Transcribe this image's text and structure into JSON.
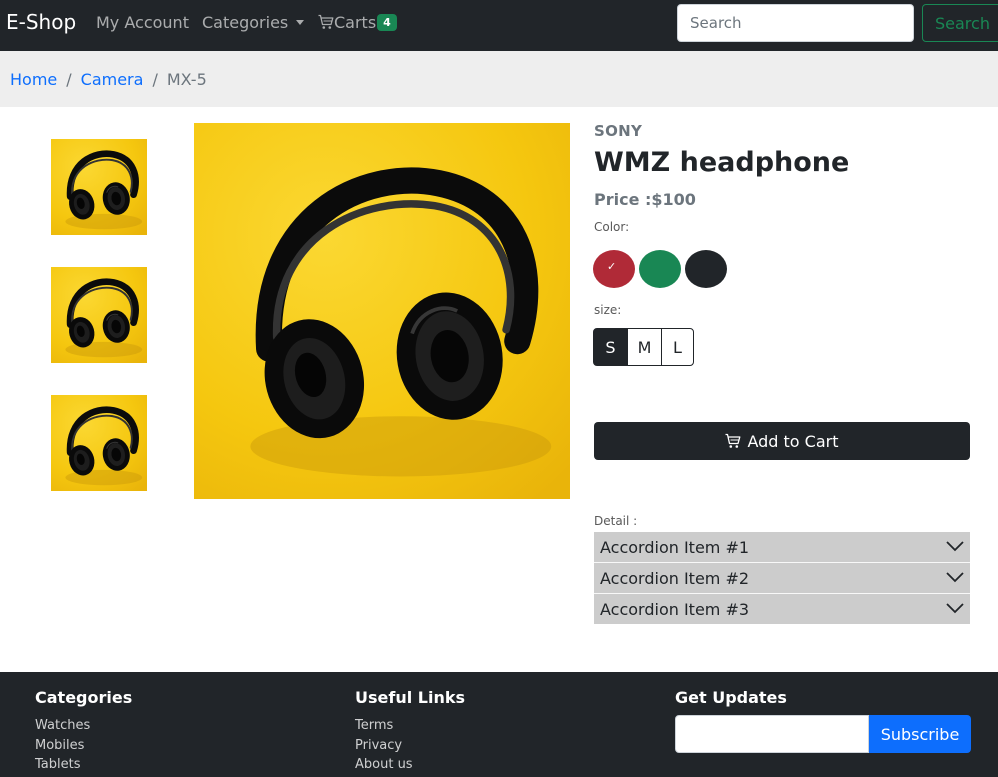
{
  "navbar": {
    "brand": "E-Shop",
    "my_account": "My Account",
    "categories": "Categories",
    "carts": "Carts",
    "cart_count": "4",
    "search_placeholder": "Search",
    "search_button": "Search"
  },
  "breadcrumb": {
    "items": [
      "Home",
      "Camera"
    ],
    "active": "MX-5",
    "separator": "/"
  },
  "product": {
    "brand": "SONY",
    "title": "WMZ headphone",
    "price": "Price :$100",
    "color_label": "Color:",
    "colors": [
      {
        "name": "red",
        "hex": "#b02a37",
        "selected": true
      },
      {
        "name": "green",
        "hex": "#198754",
        "selected": false
      },
      {
        "name": "dark",
        "hex": "#212529",
        "selected": false
      }
    ],
    "size_label": "size:",
    "sizes": [
      "S",
      "M",
      "L"
    ],
    "selected_size": "S",
    "add_to_cart": "Add to Cart",
    "detail_label": "Detail :",
    "accordion": [
      "Accordion Item #1",
      "Accordion Item #2",
      "Accordion Item #3"
    ]
  },
  "footer": {
    "categories": {
      "title": "Categories",
      "links": [
        "Watches",
        "Mobiles",
        "Tablets"
      ]
    },
    "useful_links": {
      "title": "Useful Links",
      "links": [
        "Terms",
        "Privacy",
        "About us"
      ]
    },
    "updates": {
      "title": "Get Updates",
      "email_value": "",
      "subscribe": "Subscribe"
    }
  },
  "colors": {
    "navbar_bg": "#212529",
    "link_blue": "#0d6efd",
    "success_green": "#198754",
    "accordion_bg": "#cccccc",
    "product_image_bg": "#f7c815"
  },
  "icons": [
    "cart-icon",
    "check-icon",
    "chevron-down-icon",
    "headphone-image"
  ]
}
